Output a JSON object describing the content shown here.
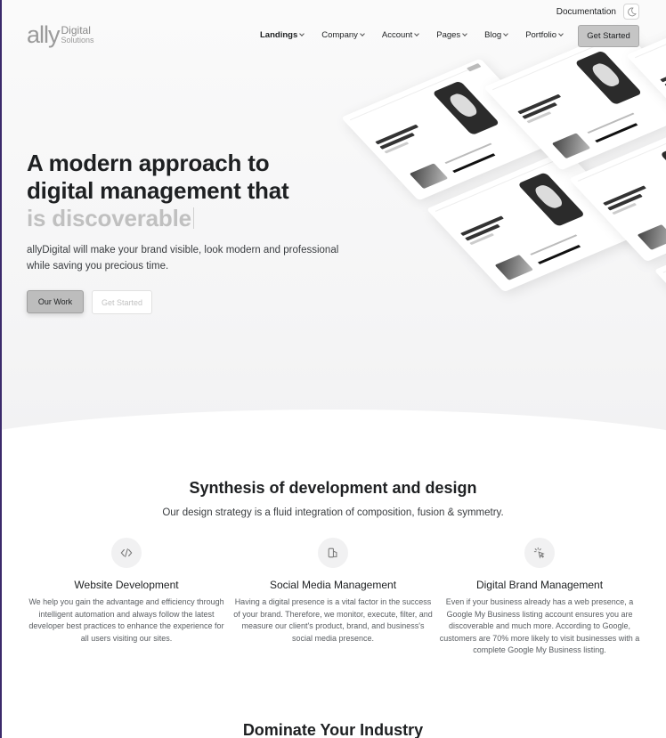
{
  "topbar": {
    "documentation_label": "Documentation"
  },
  "brand": {
    "logo_main": "ally",
    "logo_line1": "Digital",
    "logo_line2": "Solutions"
  },
  "nav": {
    "items": [
      {
        "label": "Landings"
      },
      {
        "label": "Company"
      },
      {
        "label": "Account"
      },
      {
        "label": "Pages"
      },
      {
        "label": "Blog"
      },
      {
        "label": "Portfolio"
      }
    ],
    "cta_label": "Get Started"
  },
  "hero": {
    "title_line1": "A modern approach to",
    "title_line2": "digital management that",
    "title_accent": "is discoverable",
    "description": "allyDigital will make your brand visible, look modern and professional while saving you precious time.",
    "primary_button": "Our Work",
    "secondary_button": "Get Started"
  },
  "features_section": {
    "title": "Synthesis of development and design",
    "subtitle": "Our design strategy is a fluid integration of composition, fusion & symmetry.",
    "items": [
      {
        "icon": "code-icon",
        "title": "Website Development",
        "text": "We help you gain the advantage and efficiency through intelligent automation and always follow the latest developer best practices to enhance the experience for all users visiting our sites."
      },
      {
        "icon": "social-media-icon",
        "title": "Social Media Management",
        "text": "Having a digital presence is a vital factor in the success of your brand. Therefore, we monitor, execute, filter, and measure our client's product, brand, and business's social media presence."
      },
      {
        "icon": "cursor-click-icon",
        "title": "Digital Brand Management",
        "text": "Even if your business already has a web presence, a Google My Business listing account ensures you are discoverable and much more. According to Google, customers are 70% more likely to visit businesses with a complete Google My Business listing."
      }
    ]
  },
  "next_section": {
    "title": "Dominate Your Industry"
  }
}
